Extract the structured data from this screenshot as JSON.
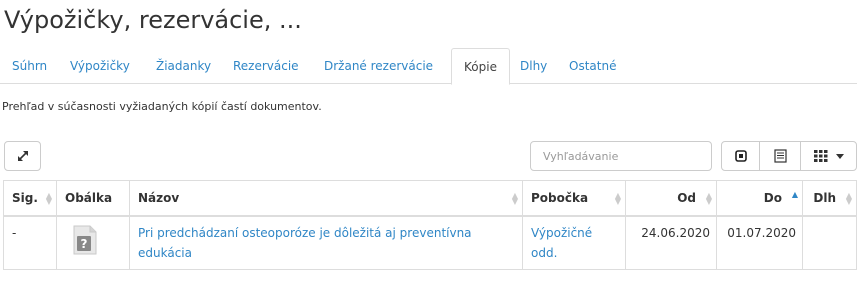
{
  "page": {
    "title": "Výpožičky, rezervácie, ..."
  },
  "tabs": [
    {
      "label": "Súhrn"
    },
    {
      "label": "Výpožičky"
    },
    {
      "label": "Žiadanky"
    },
    {
      "label": "Rezervácie"
    },
    {
      "label": "Držané rezervácie"
    },
    {
      "label": "Kópie"
    },
    {
      "label": "Dlhy"
    },
    {
      "label": "Ostatné"
    }
  ],
  "active_tab": "Kópie",
  "description": "Prehľad v súčasnosti vyžiadaných kópií častí dokumentov.",
  "toolbar": {
    "search_placeholder": "Vyhľadávanie"
  },
  "table": {
    "headers": [
      "Sig.",
      "Obálka",
      "Názov",
      "Pobočka",
      "Od",
      "Do",
      "Dlh"
    ],
    "sorted_column": "Do",
    "rows": [
      {
        "sig": "-",
        "title": "Pri predchádzaní osteoporóze je dôležitá aj preventívna edukácia",
        "branch": "Výpožičné odd.",
        "from": "24.06.2020",
        "to": "01.07.2020",
        "debt": ""
      }
    ]
  },
  "colors": {
    "link": "#2f86c6",
    "border": "#dddddd"
  }
}
